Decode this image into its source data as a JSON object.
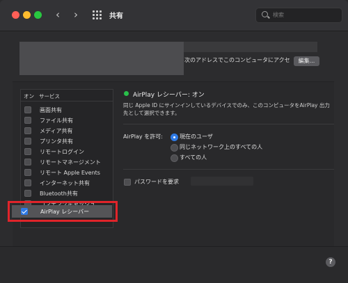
{
  "window": {
    "title": "共有",
    "search_placeholder": "検索"
  },
  "computer_name": {
    "address_text": "次のアドレスでこのコンピュータにアクセ",
    "edit_label": "編集..."
  },
  "services": {
    "header_on": "オン",
    "header_service": "サービス",
    "items": [
      {
        "label": "画面共有",
        "checked": false
      },
      {
        "label": "ファイル共有",
        "checked": false
      },
      {
        "label": "メディア共有",
        "checked": false
      },
      {
        "label": "プリンタ共有",
        "checked": false
      },
      {
        "label": "リモートログイン",
        "checked": false
      },
      {
        "label": "リモートマネージメント",
        "checked": false
      },
      {
        "label": "リモート Apple Events",
        "checked": false
      },
      {
        "label": "インターネット共有",
        "checked": false
      },
      {
        "label": "Bluetooth共有",
        "checked": false
      },
      {
        "label": "コンテンツキャッシュ",
        "checked": false
      },
      {
        "label": "AirPlay レシーバー",
        "checked": true,
        "selected": true
      }
    ]
  },
  "detail": {
    "status_text": "AirPlay レシーバー: オン",
    "status_color": "#29c04a",
    "description_line1": "同じ Apple ID にサインインしているデバイスでのみ、このコンピュータをAirPlay 出力",
    "description_line2": "先として選択できます。",
    "allow_label": "AirPlay を許可:",
    "options": [
      {
        "label": "現在のユーザ",
        "selected": true
      },
      {
        "label": "同じネットワーク上のすべての人",
        "selected": false
      },
      {
        "label": "すべての人",
        "selected": false
      }
    ],
    "password_label": "パスワードを要求",
    "password_checked": false
  },
  "accent_color": "#2f7ae5",
  "highlight_color": "#e0242a",
  "help_label": "?"
}
